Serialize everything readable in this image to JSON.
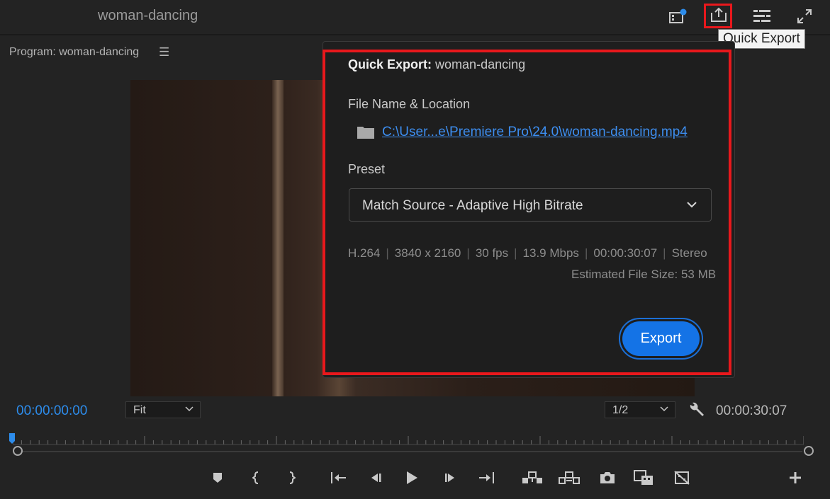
{
  "header": {
    "title": "woman-dancing",
    "tooltip": "Quick Export"
  },
  "monitor": {
    "label": "Program: woman-dancing",
    "menu_glyph": "☰"
  },
  "dialog": {
    "title_bold": "Quick Export:",
    "title_name": "woman-dancing",
    "file_label": "File Name & Location",
    "file_path": "C:\\User...e\\Premiere Pro\\24.0\\woman-dancing.mp4",
    "preset_label": "Preset",
    "preset_value": "Match Source - Adaptive High Bitrate",
    "specs": [
      "H.264",
      "3840 x 2160",
      "30 fps",
      "13.9 Mbps",
      "00:00:30:07",
      "Stereo"
    ],
    "estimated_size": "Estimated File Size: 53 MB",
    "export_label": "Export"
  },
  "controls": {
    "timecode_left": "00:00:00:00",
    "fit_value": "Fit",
    "resolution_value": "1/2",
    "timecode_right": "00:00:30:07"
  },
  "colors": {
    "accent": "#1473e6",
    "highlight": "#e8181c",
    "timecode": "#2d8ceb"
  }
}
